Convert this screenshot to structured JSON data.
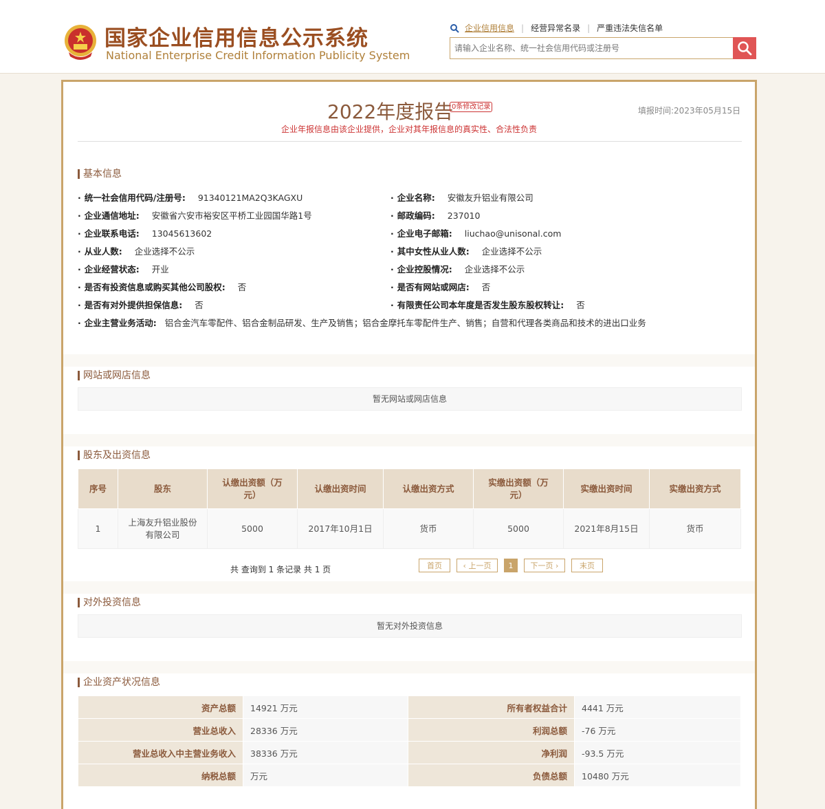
{
  "header": {
    "title_cn": "国家企业信用信息公示系统",
    "title_en": "National Enterprise Credit Information Publicity System",
    "nav_links": [
      "企业信用信息",
      "经营异常名录",
      "严重违法失信名单"
    ],
    "search_placeholder": "请输入企业名称、统一社会信用代码或注册号",
    "brand_color": "#9a4e21",
    "accent_color": "#c9a46a",
    "search_button_color": "#e05555"
  },
  "report": {
    "title": "2022年度报告",
    "mod_badge": "0条修改记录",
    "fill_time": "填报时间:2023年05月15日",
    "subtitle": "企业年报信息由该企业提供，企业对其年报信息的真实性、合法性负责"
  },
  "basic": {
    "section_title": "基本信息",
    "left": [
      {
        "k": "统一社会信用代码/注册号:",
        "v": "91340121MA2Q3KAGXU"
      },
      {
        "k": "企业通信地址:",
        "v": "安徽省六安市裕安区平桥工业园国华路1号"
      },
      {
        "k": "企业联系电话:",
        "v": "13045613602"
      },
      {
        "k": "从业人数:",
        "v": "企业选择不公示"
      },
      {
        "k": "企业经营状态:",
        "v": "开业"
      },
      {
        "k": "是否有投资信息或购买其他公司股权:",
        "v": "否"
      },
      {
        "k": "是否有对外提供担保信息:",
        "v": "否"
      }
    ],
    "right": [
      {
        "k": "企业名称:",
        "v": "安徽友升铝业有限公司"
      },
      {
        "k": "邮政编码:",
        "v": "237010"
      },
      {
        "k": "企业电子邮箱:",
        "v": "liuchao@unisonal.com"
      },
      {
        "k": "其中女性从业人数:",
        "v": "企业选择不公示"
      },
      {
        "k": "企业控股情况:",
        "v": "企业选择不公示"
      },
      {
        "k": "是否有网站或网店:",
        "v": "否"
      },
      {
        "k": "有限责任公司本年度是否发生股东股权转让:",
        "v": "否"
      }
    ],
    "business_scope": {
      "k": "企业主营业务活动:",
      "v": "铝合金汽车零配件、铝合金制品研发、生产及销售；铝合金摩托车零配件生产、销售；自营和代理各类商品和技术的进出口业务"
    }
  },
  "website": {
    "section_title": "网站或网店信息",
    "empty": "暂无网站或网店信息"
  },
  "shareholders": {
    "section_title": "股东及出资信息",
    "headers": [
      "序号",
      "股东",
      "认缴出资额（万元）",
      "认缴出资时间",
      "认缴出资方式",
      "实缴出资额（万元）",
      "实缴出资时间",
      "实缴出资方式"
    ],
    "rows": [
      [
        "1",
        "上海友升铝业股份有限公司",
        "5000",
        "2017年10月1日",
        "货币",
        "5000",
        "2021年8月15日",
        "货币"
      ]
    ],
    "page_info": "共 查询到 1 条记录 共 1 页",
    "pager": {
      "first": "首页",
      "prev": "上一页",
      "current": "1",
      "next": "下一页",
      "last": "末页"
    }
  },
  "investment": {
    "section_title": "对外投资信息",
    "empty": "暂无对外投资信息"
  },
  "assets": {
    "section_title": "企业资产状况信息",
    "rows": [
      [
        "资产总额",
        "14921 万元",
        "所有者权益合计",
        "4441 万元"
      ],
      [
        "营业总收入",
        "28336 万元",
        "利润总额",
        "-76 万元"
      ],
      [
        "营业总收入中主营业务收入",
        "38336 万元",
        "净利润",
        "-93.5 万元"
      ],
      [
        "纳税总额",
        "万元",
        "负债总额",
        "10480 万元"
      ]
    ]
  }
}
